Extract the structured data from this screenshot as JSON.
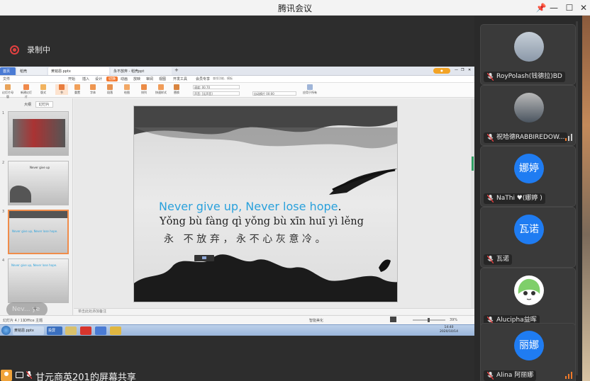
{
  "window": {
    "title": "腾讯会议",
    "controls": {
      "pin": "📌",
      "minimize": "—",
      "maximize": "☐",
      "close": "✕"
    }
  },
  "recording": {
    "label": "录制中"
  },
  "share_bar": {
    "label": "甘元商英201的屏幕共享"
  },
  "participants": [
    {
      "name": "RoyPolash(钱德拉)BD",
      "avatar_type": "photo",
      "avatar_text": "",
      "color": "#9aa6b8"
    },
    {
      "name": "祝哈德RABBIREDOW...",
      "avatar_type": "photo",
      "avatar_text": "",
      "color": "#6b7a8a",
      "signal": true
    },
    {
      "name": "NaThi ♥(娜婷 )",
      "avatar_type": "initials",
      "avatar_text": "娜婷",
      "color": "#1f7cf2"
    },
    {
      "name": "瓦诺",
      "avatar_type": "initials",
      "avatar_text": "瓦诺",
      "color": "#1f7cf2"
    },
    {
      "name": "Alucipha益晖",
      "avatar_type": "anime",
      "avatar_text": "",
      "color": "#7fcf6a"
    },
    {
      "name": "Alina 阿丽娜",
      "avatar_type": "initials",
      "avatar_text": "丽娜",
      "color": "#1f7cf2",
      "signal": true
    }
  ],
  "shared_screen": {
    "browser_tabs": [
      "首页",
      "稻壳",
      "黄铭恩.pptx",
      "永不放弃 - 稻壳ppt",
      "+"
    ],
    "menu_items": [
      "文件",
      "开始",
      "插入",
      "设计",
      "切换",
      "动画",
      "放映",
      "审阅",
      "视图",
      "开发工具",
      "会员专享"
    ],
    "active_menu": "切换",
    "search_placeholder": "查找功能、模板",
    "ribbon_buttons": [
      "幻灯片母版",
      "新建幻灯片",
      "版式",
      "节",
      "重置",
      "字体",
      "段落",
      "绘图",
      "排列",
      "快速样式",
      "替换",
      "选择",
      "文本框",
      "形状"
    ],
    "ribbon_fields": {
      "duration": "速度: 00.70",
      "sound": "声音: [无声音]",
      "auto": "自动换片 00:00"
    },
    "ribbon_right": "应用于所有",
    "thumb_tabs": [
      "大纲",
      "幻灯片"
    ],
    "active_thumb_tab": "幻灯片",
    "thumbnails": [
      {
        "num": "1",
        "text": ""
      },
      {
        "num": "2",
        "text": "Never give up"
      },
      {
        "num": "3",
        "text": "Never give up, Never lose hope."
      },
      {
        "num": "4",
        "text": "Never give up, Never lose hope."
      }
    ],
    "overlay_chip": "Nev... ye",
    "slide": {
      "english": "Never give up, Never lose hope",
      "english_period": ".",
      "pinyin": "Yǒng bù fàng qì    yǒng bù xīn huī yì lěng",
      "chinese": "永  不放弃，永不心灰意冷。"
    },
    "notes_placeholder": "单击此处添加备注",
    "status": {
      "left": "幻灯片 4 / 11",
      "theme": "Office 主题",
      "right": "智能美化",
      "zoom": "39%"
    },
    "taskbar": {
      "items": [
        "黄铭恩.pptx",
        "投屏",
        "WPS Office"
      ],
      "clock_time": "14:40",
      "clock_date": "2020/10/14"
    }
  }
}
